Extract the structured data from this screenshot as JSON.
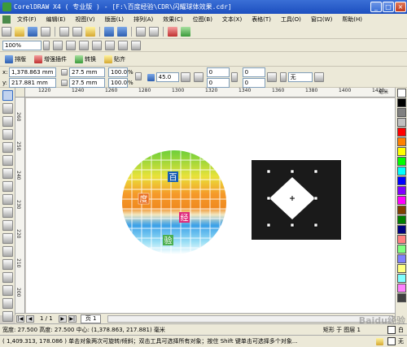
{
  "window": {
    "title": "CorelDRAW X4 ( 专业版 ) - [F:\\百度经验\\CDR\\闪耀球体效果.cdr]"
  },
  "menu": [
    "文件(F)",
    "编辑(E)",
    "视图(V)",
    "版面(L)",
    "排列(A)",
    "效果(C)",
    "位图(B)",
    "文本(X)",
    "表格(T)",
    "工具(O)",
    "窗口(W)",
    "帮助(H)"
  ],
  "zoom": {
    "value": "100%"
  },
  "plugins": [
    "排版",
    "增强插件",
    "转换",
    "贴齐"
  ],
  "props": {
    "x": "1,378.863 mm",
    "y": "217.881 mm",
    "width": "27.5 mm",
    "height": "27.5 mm",
    "scale_x": "100.0",
    "scale_y": "100.0",
    "pct": "%",
    "angle": "45.0",
    "corner_a": "0",
    "corner_b": "0",
    "corner_c": "0",
    "corner_d": "0",
    "outline": "无"
  },
  "ruler_h": [
    "1220",
    "1240",
    "1260",
    "1280",
    "1300",
    "1320",
    "1340",
    "1360",
    "1380",
    "1400",
    "1420"
  ],
  "ruler_v": [
    "260",
    "250",
    "240",
    "230",
    "220",
    "210",
    "200"
  ],
  "ruler_unit": "毫米",
  "canvas": {
    "ball_labels": [
      "百",
      "度",
      "经",
      "验"
    ]
  },
  "pages": {
    "counter": "1 / 1",
    "tab": "页 1"
  },
  "status": {
    "line1": "宽度: 27.500 高度: 27.500 中心: (1,378.863, 217.881) 毫米",
    "object": "矩形 于 图层 1",
    "fill": "白",
    "line2": "( 1,409.313, 178.086 ) 单击对象两次可旋转/倾斜；双击工具可选择所有对象；按住 Shift 键单击可选择多个对象...",
    "outline": "无"
  },
  "colors": {
    "title_bar": "#2a5cc8",
    "canvas_bg": "#ffffff",
    "black_rect": "#1a1a1a"
  },
  "palette": [
    "#ffffff",
    "#000000",
    "#808080",
    "#c0c0c0",
    "#ff0000",
    "#ff8000",
    "#ffff00",
    "#00ff00",
    "#00ffff",
    "#0000ff",
    "#8000ff",
    "#ff00ff",
    "#804000",
    "#008000",
    "#000080",
    "#ff8080",
    "#80ff80",
    "#8080ff",
    "#ffff80",
    "#80ffff",
    "#ff80ff",
    "#404040"
  ],
  "watermark": "Baidu经验"
}
